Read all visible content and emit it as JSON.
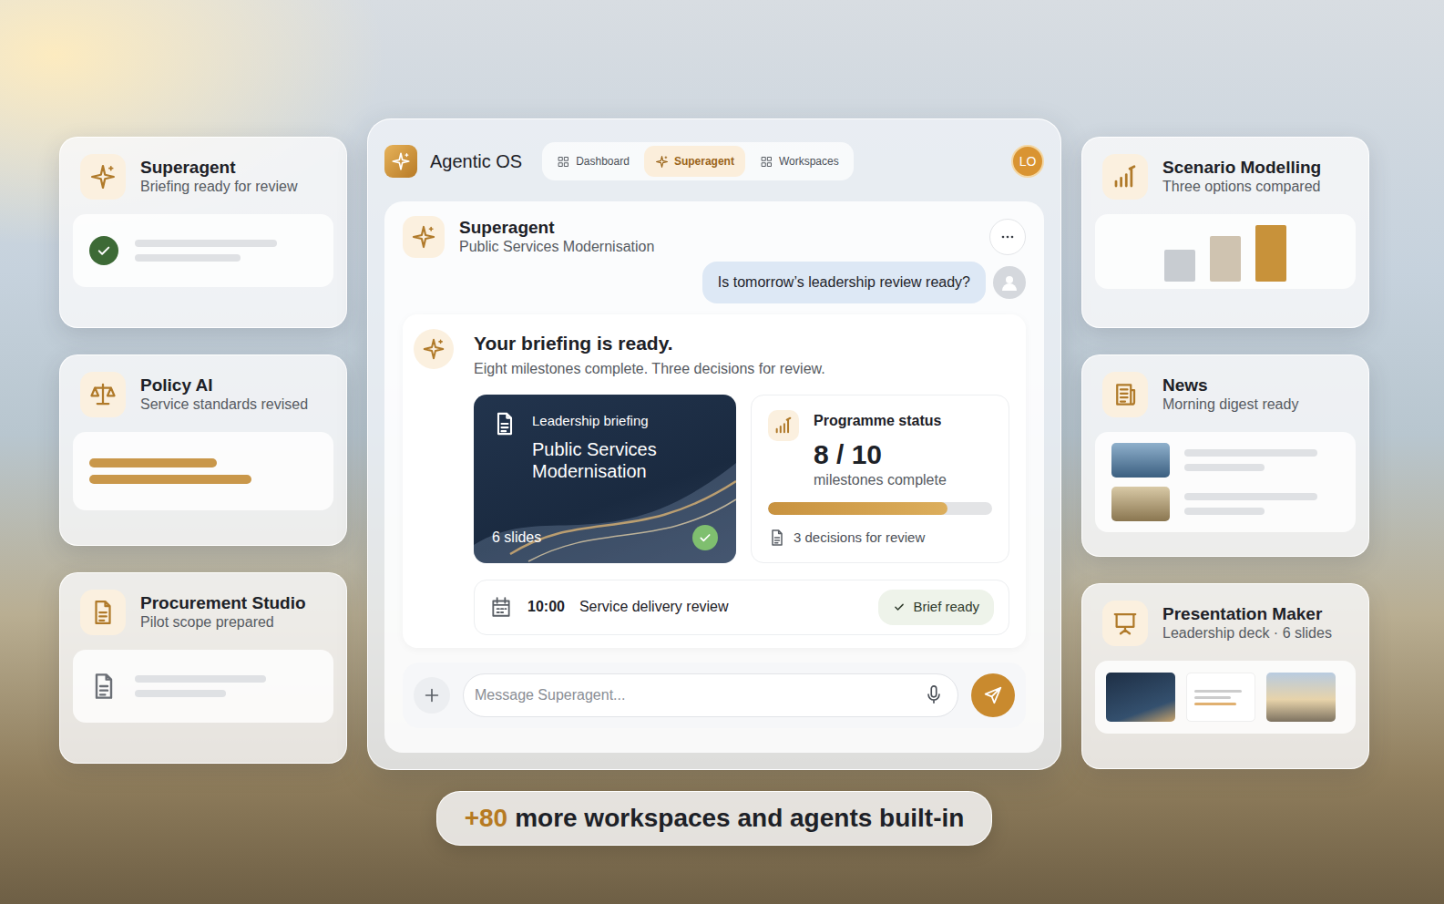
{
  "app": {
    "name": "Agentic OS",
    "nav": [
      {
        "label": "Dashboard",
        "selected": false
      },
      {
        "label": "Superagent",
        "selected": true
      },
      {
        "label": "Workspaces",
        "selected": false
      }
    ],
    "avatar": "LO"
  },
  "chat": {
    "agent": "Superagent",
    "project": "Public Services Modernisation",
    "user_message": "Is tomorrow’s leadership review ready?",
    "reply_title": "Your briefing is ready.",
    "reply_subtitle": "Eight milestones complete. Three decisions for review.",
    "briefing_card": {
      "label": "Leadership briefing",
      "title": "Public Services Modernisation",
      "slides": "6 slides",
      "done": true
    },
    "status_card": {
      "title": "Programme status",
      "value": "8 / 10",
      "caption": "milestones complete",
      "level": 0.8,
      "decisions": "3 decisions for review"
    },
    "meeting": {
      "time": "10:00",
      "title": "Service delivery review",
      "badge": "Brief ready"
    },
    "composer": {
      "placeholder": "Message Superagent..."
    }
  },
  "left_cards": [
    {
      "kind": "check",
      "title": "Superagent",
      "subtitle": "Briefing ready for review"
    },
    {
      "kind": "bars",
      "title": "Policy AI",
      "subtitle": "Service standards revised"
    },
    {
      "kind": "doc",
      "title": "Procurement Studio",
      "subtitle": "Pilot scope prepared"
    }
  ],
  "right_cards": [
    {
      "kind": "chart",
      "title": "Scenario Modelling",
      "subtitle": "Three options compared",
      "bars": [
        {
          "value": 35,
          "color": "#c8ccd1"
        },
        {
          "value": 50,
          "color": "#cfc3b0"
        },
        {
          "value": 62,
          "color": "#c8923a"
        }
      ]
    },
    {
      "kind": "news",
      "title": "News",
      "subtitle": "Morning digest ready"
    },
    {
      "kind": "slides",
      "title": "Presentation Maker",
      "subtitle": "Leadership deck · 6 slides"
    }
  ],
  "footer": {
    "count": "+80",
    "text": "more workspaces and agents built-in"
  }
}
